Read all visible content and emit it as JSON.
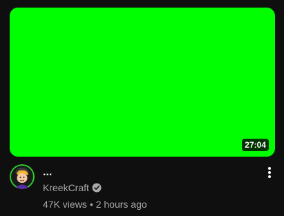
{
  "video": {
    "thumbnail_color": "#00ff00",
    "duration": "27:04",
    "title": "...",
    "channel_name": "KreekCraft",
    "views": "47K views",
    "meta_separator": "•",
    "age": "2 hours ago"
  },
  "icons": {
    "avatar": "avatar",
    "verified": "verified-check-icon",
    "more": "more-vertical-icon"
  },
  "colors": {
    "background": "#0f0f0f",
    "primary_text": "#f1f1f1",
    "secondary_text": "#aaaaaa",
    "badge_background": "#000000"
  }
}
